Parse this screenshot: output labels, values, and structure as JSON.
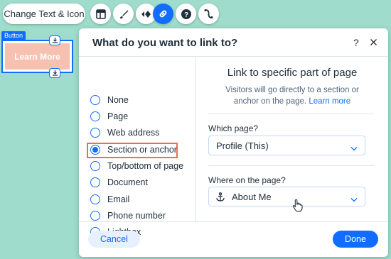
{
  "toolbar": {
    "change_text_label": "Change Text & Icon",
    "icons": [
      "layout-icon",
      "design-brush-icon",
      "animation-icon",
      "link-icon",
      "help-icon",
      "connect-icon"
    ]
  },
  "element": {
    "tag": "Button",
    "button_text": "Learn More"
  },
  "dialog": {
    "title": "What do you want to link to?",
    "help": "?",
    "link_options": [
      {
        "label": "None",
        "checked": false
      },
      {
        "label": "Page",
        "checked": false
      },
      {
        "label": "Web address",
        "checked": false
      },
      {
        "label": "Section or anchor",
        "checked": true
      },
      {
        "label": "Top/bottom of page",
        "checked": false
      },
      {
        "label": "Document",
        "checked": false
      },
      {
        "label": "Email",
        "checked": false
      },
      {
        "label": "Phone number",
        "checked": false
      },
      {
        "label": "Lightbox",
        "checked": false
      }
    ],
    "panel": {
      "title": "Link to specific part of page",
      "description": "Visitors will go directly to a section or anchor on the page.",
      "learn_more": "Learn more",
      "which_page_label": "Which page?",
      "which_page_value": "Profile (This)",
      "where_label": "Where on the page?",
      "where_value": "About Me"
    },
    "cancel_label": "Cancel",
    "done_label": "Done"
  },
  "colors": {
    "accent": "#116dff",
    "canvas_bg": "#9fdccb",
    "button_fill": "#f6c1b1",
    "highlight": "#e8704f"
  }
}
